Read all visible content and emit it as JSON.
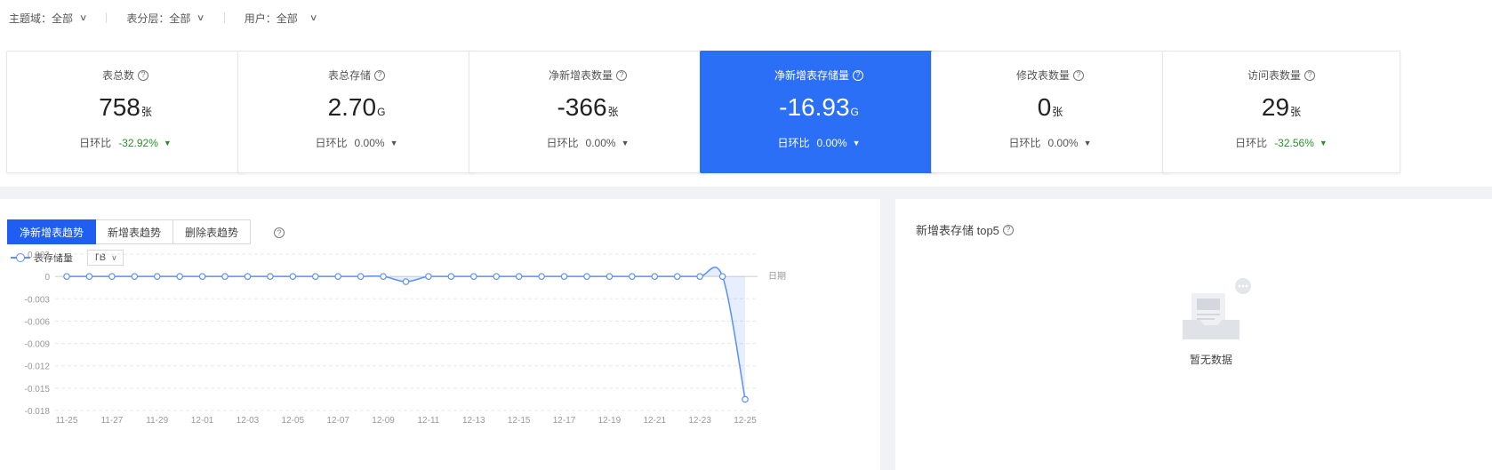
{
  "filters": [
    {
      "label": "主题域：全部"
    },
    {
      "label": "表分层：全部"
    },
    {
      "label": "用户：全部"
    }
  ],
  "cards": [
    {
      "title": "表总数",
      "value": "758",
      "unit": "张",
      "cmp_label": "日环比",
      "cmp_value": "-32.92%",
      "trend": "down"
    },
    {
      "title": "表总存储",
      "value": "2.70",
      "unit": "G",
      "cmp_label": "日环比",
      "cmp_value": "0.00%",
      "trend": "flat"
    },
    {
      "title": "净新增表数量",
      "value": "-366",
      "unit": "张",
      "cmp_label": "日环比",
      "cmp_value": "0.00%",
      "trend": "flat"
    },
    {
      "title": "净新增表存储量",
      "value": "-16.93",
      "unit": "G",
      "cmp_label": "日环比",
      "cmp_value": "0.00%",
      "trend": "flat"
    },
    {
      "title": "修改表数量",
      "value": "0",
      "unit": "张",
      "cmp_label": "日环比",
      "cmp_value": "0.00%",
      "trend": "flat"
    },
    {
      "title": "访问表数量",
      "value": "29",
      "unit": "张",
      "cmp_label": "日环比",
      "cmp_value": "-32.56%",
      "trend": "down"
    }
  ],
  "trend_tabs": [
    {
      "label": "净新增表趋势",
      "active": true
    },
    {
      "label": "新增表趋势",
      "active": false
    },
    {
      "label": "删除表趋势",
      "active": false
    }
  ],
  "legend": {
    "series_label": "表存储量",
    "unit_value": "TB"
  },
  "colors": {
    "accent": "#2a6ff5",
    "series": "#5b8ff9",
    "down": "#2e8b2e"
  },
  "chart_data": {
    "type": "area",
    "x_axis_label": "日期",
    "x": [
      "11-25",
      "11-26",
      "11-27",
      "11-28",
      "11-29",
      "11-30",
      "12-01",
      "12-02",
      "12-03",
      "12-04",
      "12-05",
      "12-06",
      "12-07",
      "12-08",
      "12-09",
      "12-10",
      "12-11",
      "12-12",
      "12-13",
      "12-14",
      "12-15",
      "12-16",
      "12-17",
      "12-18",
      "12-19",
      "12-20",
      "12-21",
      "12-22",
      "12-23",
      "12-24",
      "12-25"
    ],
    "x_tick_labels": [
      "11-25",
      "11-27",
      "11-29",
      "12-01",
      "12-03",
      "12-05",
      "12-07",
      "12-09",
      "12-11",
      "12-13",
      "12-15",
      "12-17",
      "12-19",
      "12-21",
      "12-23",
      "12-25"
    ],
    "series": [
      {
        "name": "表存储量",
        "values": [
          0,
          0,
          0,
          0,
          0,
          0,
          0,
          0,
          0,
          0,
          0,
          0,
          0,
          0,
          0,
          -0.0007,
          0,
          0,
          0,
          0,
          0,
          0,
          0,
          0,
          0,
          0,
          0,
          0,
          0,
          0,
          -0.0165
        ]
      }
    ],
    "y_ticks": [
      "0.003",
      "0",
      "-0.003",
      "-0.006",
      "-0.009",
      "-0.012",
      "-0.015",
      "-0.018"
    ],
    "ylim": [
      -0.018,
      0.003
    ]
  },
  "top5": {
    "title": "新增表存储 top5",
    "empty_text": "暂无数据"
  }
}
